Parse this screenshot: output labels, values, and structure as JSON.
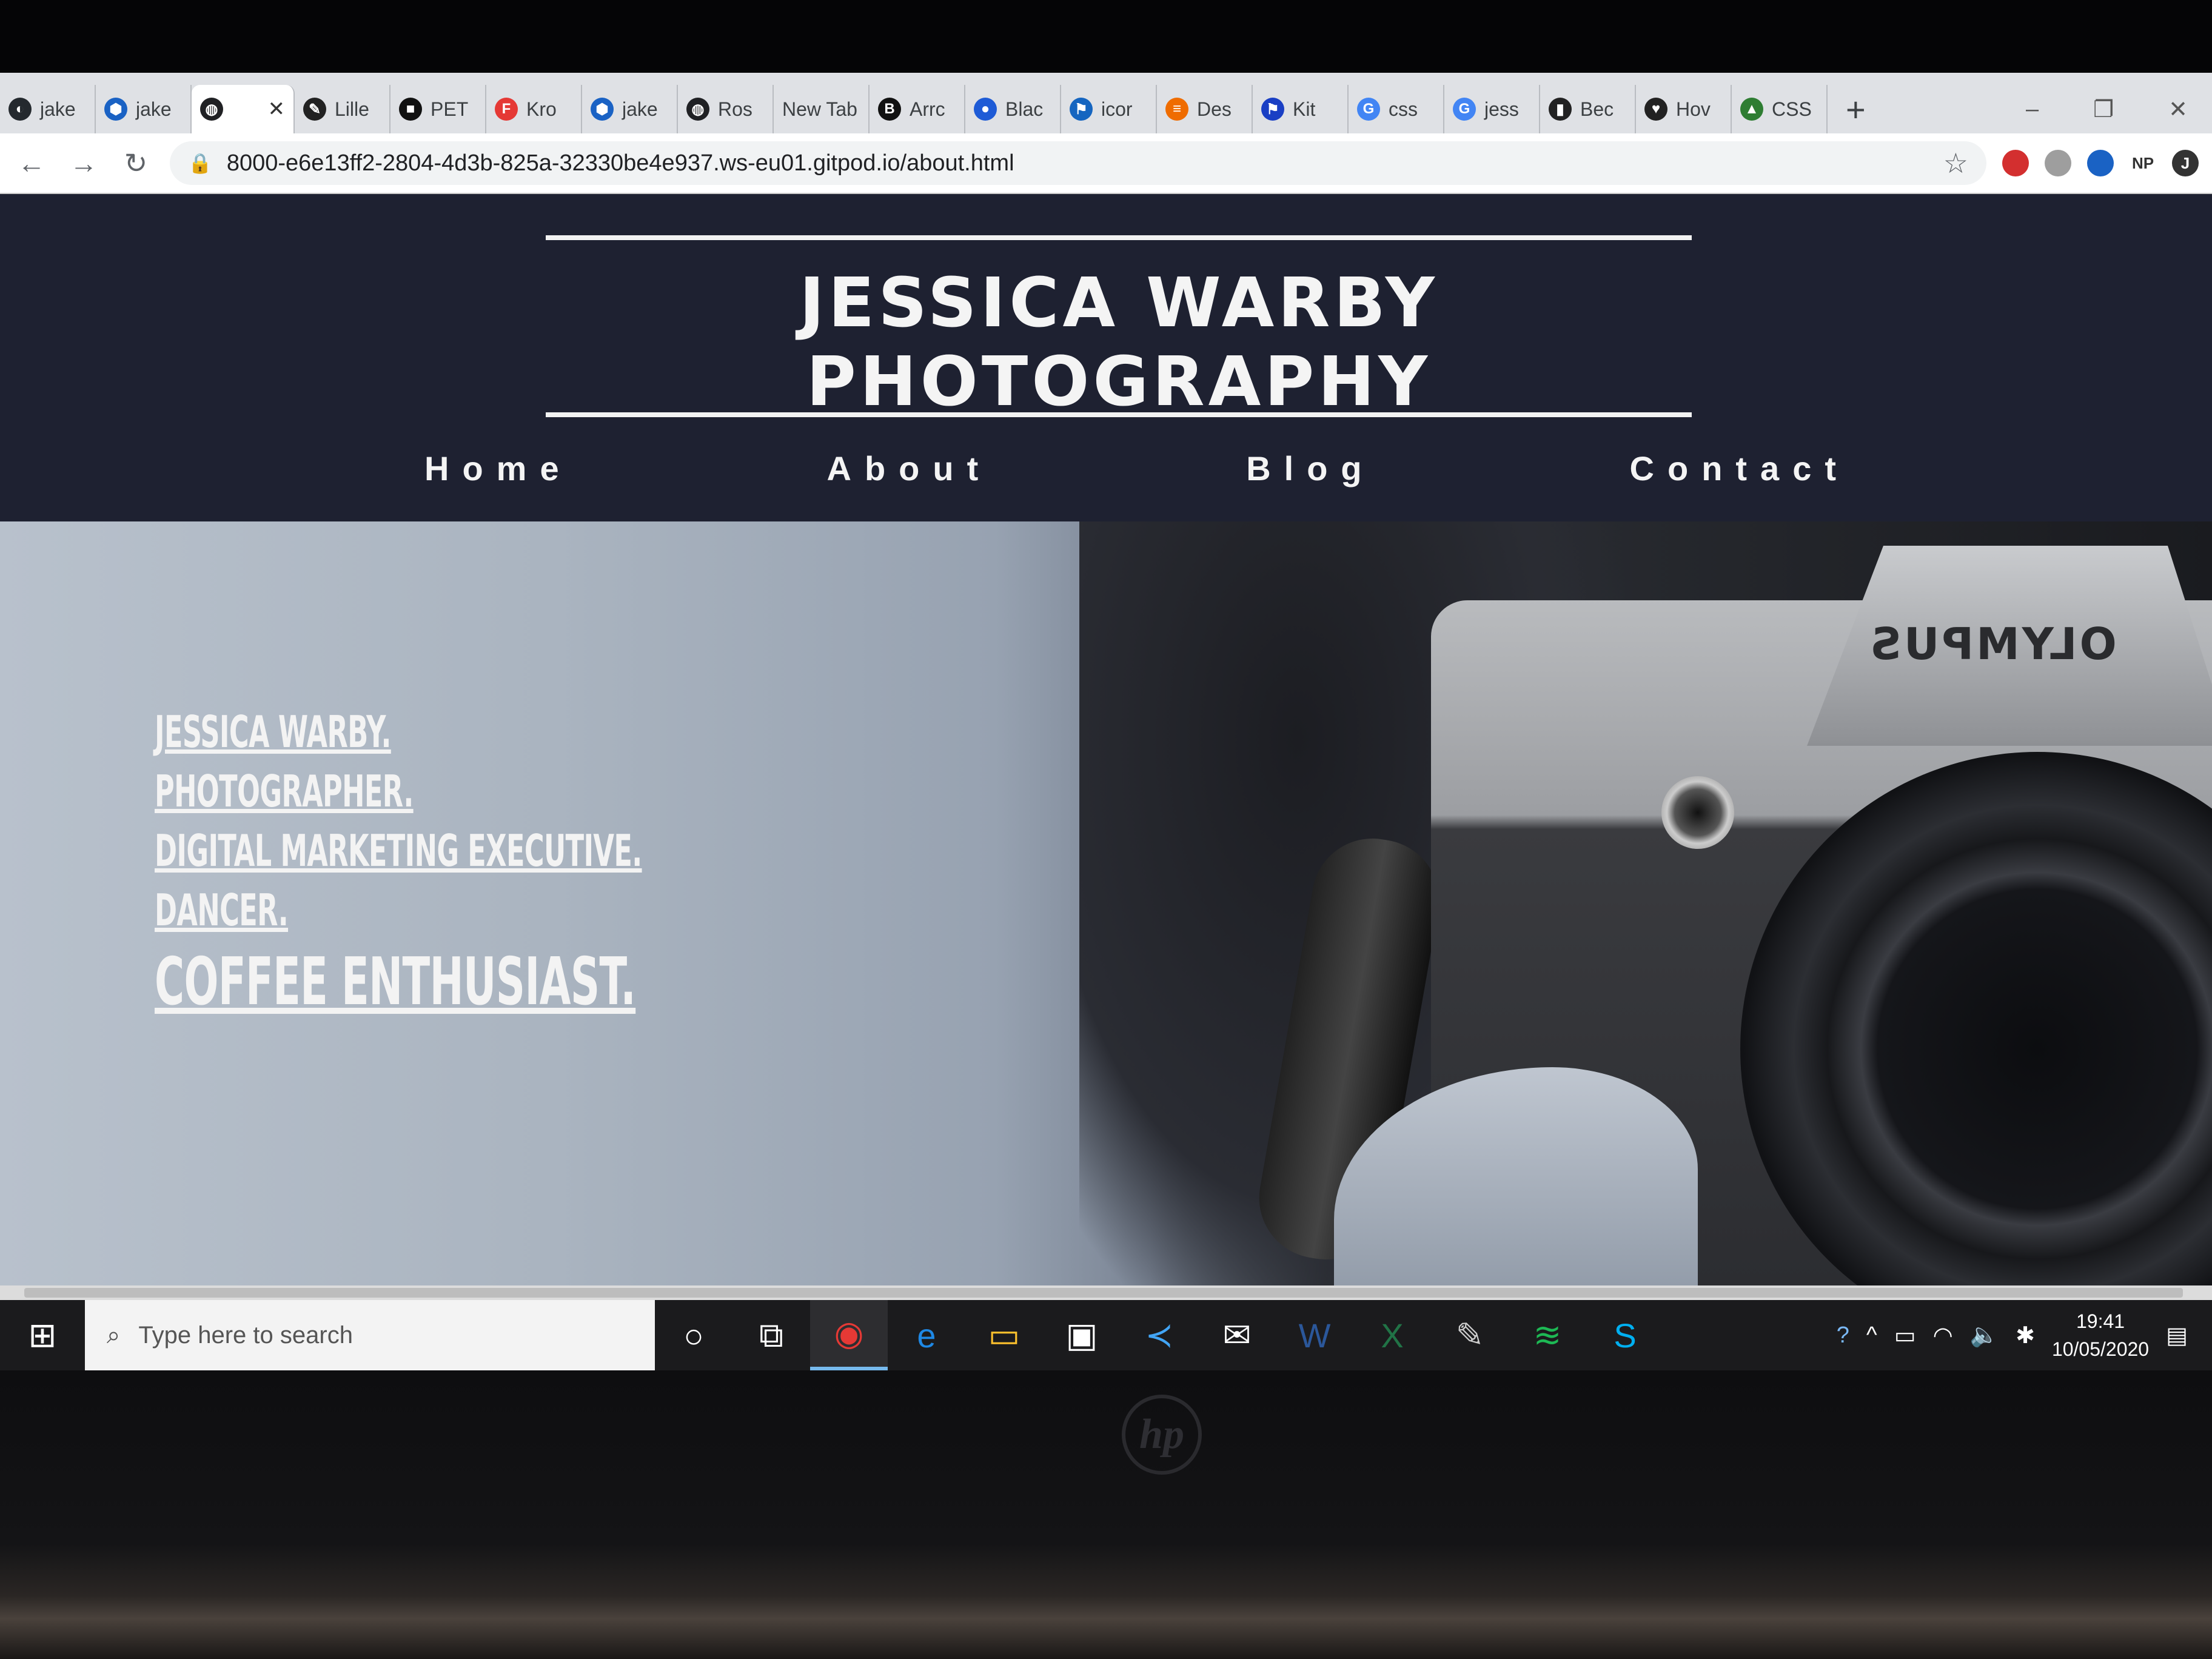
{
  "browser": {
    "tabs": [
      {
        "label": "jake",
        "icon": "github-icon",
        "color": "#24292e"
      },
      {
        "label": "jake",
        "icon": "gitpod-hex-icon",
        "color": "#1a62c4"
      },
      {
        "label": "",
        "icon": "globe-icon",
        "color": "#202124",
        "active": true
      },
      {
        "label": "Lille",
        "icon": "pen-icon",
        "color": "#222"
      },
      {
        "label": "PET",
        "icon": "square-icon",
        "color": "#111"
      },
      {
        "label": "Kro",
        "icon": "f-icon",
        "color": "#e53935"
      },
      {
        "label": "jake",
        "icon": "gitpod-hex-icon",
        "color": "#1a62c4"
      },
      {
        "label": "Ros",
        "icon": "globe-icon",
        "color": "#202124"
      },
      {
        "label": "New Tab",
        "icon": "",
        "color": ""
      },
      {
        "label": "Arrc",
        "icon": "b-icon",
        "color": "#111"
      },
      {
        "label": "Blac",
        "icon": "flickr-icon",
        "color": "#1e5bd6"
      },
      {
        "label": "icor",
        "icon": "flag-icon",
        "color": "#1565c0"
      },
      {
        "label": "Des",
        "icon": "stack-icon",
        "color": "#ef6c00"
      },
      {
        "label": "Kit",
        "icon": "flag-icon",
        "color": "#1a3fc4"
      },
      {
        "label": "css",
        "icon": "google-icon",
        "color": "#4285f4"
      },
      {
        "label": "jess",
        "icon": "google-icon",
        "color": "#4285f4"
      },
      {
        "label": "Bec",
        "icon": "book-icon",
        "color": "#222"
      },
      {
        "label": "Hov",
        "icon": "heart-icon",
        "color": "#222"
      },
      {
        "label": "CSS",
        "icon": "chart-icon",
        "color": "#2e7d32"
      }
    ],
    "new_tab_symbol": "+",
    "window_controls": [
      "–",
      "❐",
      "✕"
    ],
    "url": "8000-e6e13ff2-2804-4d3b-825a-32330be4e937.ws-eu01.gitpod.io/about.html",
    "extensions": [
      {
        "label": "",
        "color": "#d32f2f",
        "icon": "shield-ext-icon"
      },
      {
        "label": "",
        "color": "#9e9e9e",
        "icon": "box-ext-icon"
      },
      {
        "label": "",
        "color": "#1a62c4",
        "icon": "hex-ext-icon"
      },
      {
        "label": "NP",
        "color": "#ffffff",
        "icon": "np-ext-icon"
      },
      {
        "label": "J",
        "color": "#333333",
        "icon": "profile-avatar"
      }
    ]
  },
  "site": {
    "brand": "JESSICA WARBY PHOTOGRAPHY",
    "nav": [
      "Home",
      "About",
      "Blog",
      "Contact"
    ],
    "hero_lines": [
      "JESSICA WARBY.",
      "PHOTOGRAPHER.",
      "DIGITAL MARKETING EXECUTIVE.",
      "DANCER.",
      "COFFEE ENTHUSIAST."
    ],
    "camera_brand": "OLYMPUS"
  },
  "taskbar": {
    "search_placeholder": "Type here to search",
    "apps": [
      {
        "name": "cortana-icon",
        "symbol": "○",
        "color": "#ffffff"
      },
      {
        "name": "task-view-icon",
        "symbol": "⧉",
        "color": "#ffffff"
      },
      {
        "name": "chrome-icon",
        "symbol": "◉",
        "color": "#e53935",
        "active": true
      },
      {
        "name": "edge-icon",
        "symbol": "e",
        "color": "#1e88e5"
      },
      {
        "name": "file-explorer-icon",
        "symbol": "▭",
        "color": "#fbc02d"
      },
      {
        "name": "store-icon",
        "symbol": "▣",
        "color": "#ffffff"
      },
      {
        "name": "vscode-icon",
        "symbol": "≺",
        "color": "#42a5f5"
      },
      {
        "name": "mail-icon",
        "symbol": "✉",
        "color": "#ffffff"
      },
      {
        "name": "word-icon",
        "symbol": "W",
        "color": "#2b579a"
      },
      {
        "name": "excel-icon",
        "symbol": "X",
        "color": "#217346"
      },
      {
        "name": "pen-app-icon",
        "symbol": "✎",
        "color": "#cccccc"
      },
      {
        "name": "spotify-icon",
        "symbol": "≋",
        "color": "#1db954"
      },
      {
        "name": "skype-icon",
        "symbol": "S",
        "color": "#00aff0"
      }
    ],
    "tray": [
      "?",
      "^",
      "▭",
      "◠",
      "🔈",
      "✱"
    ],
    "time": "19:41",
    "date": "10/05/2020"
  },
  "device": {
    "logo": "hp"
  }
}
